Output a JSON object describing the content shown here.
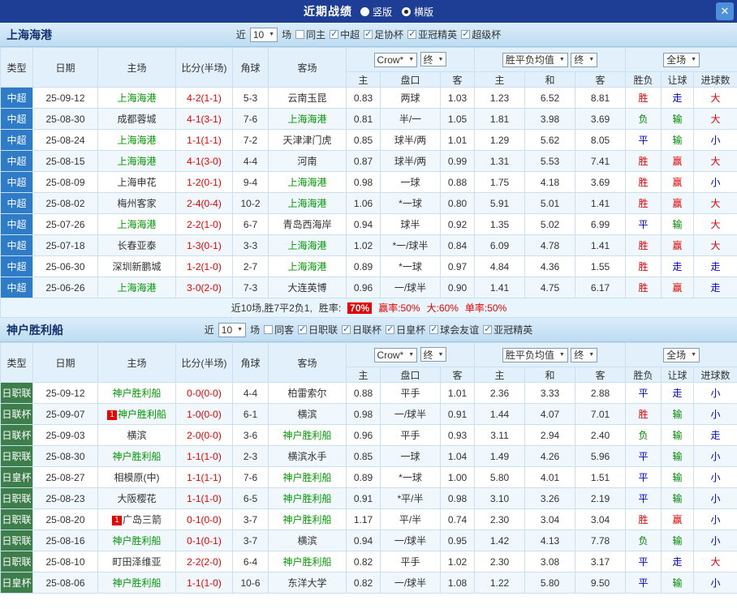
{
  "topbar": {
    "title": "近期战绩",
    "options": [
      {
        "label": "竖版",
        "selected": false
      },
      {
        "label": "横版",
        "selected": true
      }
    ],
    "close_icon": "✕"
  },
  "colors": {
    "topbar_bg": "#1d3e94",
    "close_bg": "#4d8fdb",
    "band_bg": "#cde5f6",
    "header_bg": "#e1f0fb",
    "csl_badge": "#2e7bc8",
    "jp_badge": "#3e7e4b",
    "team_selected": "#009900",
    "score": "#e60000",
    "result_red": "#e60000",
    "result_blue": "#0000dd",
    "result_green": "#008800",
    "rate_badge_bg": "#e60000"
  },
  "sections": [
    {
      "team": "上海海港",
      "recent_prefix": "近",
      "recent_count": "10",
      "recent_suffix": "场",
      "filters": [
        {
          "label": "同主",
          "checked": false
        },
        {
          "label": "中超",
          "checked": true
        },
        {
          "label": "足协杯",
          "checked": true
        },
        {
          "label": "亚冠精英",
          "checked": true
        },
        {
          "label": "超级杯",
          "checked": true
        }
      ],
      "dropdowns": [
        {
          "name": "bookmaker-select",
          "label": "Crow*"
        },
        {
          "name": "asia-stage-select",
          "label": "终"
        },
        {
          "name": "europe-odds-select",
          "label": "胜平负均值"
        },
        {
          "name": "europe-stage-select",
          "label": "终"
        },
        {
          "name": "scope-select",
          "label": "全场"
        }
      ],
      "main_headers": [
        "类型",
        "日期",
        "主场",
        "比分(半场)",
        "角球",
        "客场"
      ],
      "sub_headers": [
        "主",
        "盘口",
        "客",
        "主",
        "和",
        "客",
        "胜负",
        "让球",
        "进球数"
      ],
      "rows": [
        {
          "league": "中超",
          "date": "25-09-12",
          "home_badge": "",
          "home": "上海海港",
          "home_selected": true,
          "score": "4-2(1-1)",
          "corners": "5-3",
          "away_badge": "",
          "away": "云南玉昆",
          "away_selected": false,
          "asia_home": "0.83",
          "handicap": "两球",
          "asia_away": "1.03",
          "euro_home": "1.23",
          "euro_draw": "6.52",
          "euro_away": "8.81",
          "result": "胜",
          "handicap_result": "走",
          "goals_result": "大"
        },
        {
          "league": "中超",
          "date": "25-08-30",
          "home_badge": "",
          "home": "成都蓉城",
          "home_selected": false,
          "score": "4-1(3-1)",
          "corners": "7-6",
          "away_badge": "",
          "away": "上海海港",
          "away_selected": true,
          "asia_home": "0.81",
          "handicap": "半/一",
          "asia_away": "1.05",
          "euro_home": "1.81",
          "euro_draw": "3.98",
          "euro_away": "3.69",
          "result": "负",
          "handicap_result": "输",
          "goals_result": "大"
        },
        {
          "league": "中超",
          "date": "25-08-24",
          "home_badge": "",
          "home": "上海海港",
          "home_selected": true,
          "score": "1-1(1-1)",
          "corners": "7-2",
          "away_badge": "",
          "away": "天津津门虎",
          "away_selected": false,
          "asia_home": "0.85",
          "handicap": "球半/两",
          "asia_away": "1.01",
          "euro_home": "1.29",
          "euro_draw": "5.62",
          "euro_away": "8.05",
          "result": "平",
          "handicap_result": "输",
          "goals_result": "小"
        },
        {
          "league": "中超",
          "date": "25-08-15",
          "home_badge": "",
          "home": "上海海港",
          "home_selected": true,
          "score": "4-1(3-0)",
          "corners": "4-4",
          "away_badge": "",
          "away": "河南",
          "away_selected": false,
          "asia_home": "0.87",
          "handicap": "球半/两",
          "asia_away": "0.99",
          "euro_home": "1.31",
          "euro_draw": "5.53",
          "euro_away": "7.41",
          "result": "胜",
          "handicap_result": "赢",
          "goals_result": "大"
        },
        {
          "league": "中超",
          "date": "25-08-09",
          "home_badge": "",
          "home": "上海申花",
          "home_selected": false,
          "score": "1-2(0-1)",
          "corners": "9-4",
          "away_badge": "",
          "away": "上海海港",
          "away_selected": true,
          "asia_home": "0.98",
          "handicap": "一球",
          "asia_away": "0.88",
          "euro_home": "1.75",
          "euro_draw": "4.18",
          "euro_away": "3.69",
          "result": "胜",
          "handicap_result": "赢",
          "goals_result": "小"
        },
        {
          "league": "中超",
          "date": "25-08-02",
          "home_badge": "",
          "home": "梅州客家",
          "home_selected": false,
          "score": "2-4(0-4)",
          "corners": "10-2",
          "away_badge": "",
          "away": "上海海港",
          "away_selected": true,
          "asia_home": "1.06",
          "handicap": "*一球",
          "asia_away": "0.80",
          "euro_home": "5.91",
          "euro_draw": "5.01",
          "euro_away": "1.41",
          "result": "胜",
          "handicap_result": "赢",
          "goals_result": "大"
        },
        {
          "league": "中超",
          "date": "25-07-26",
          "home_badge": "",
          "home": "上海海港",
          "home_selected": true,
          "score": "2-2(1-0)",
          "corners": "6-7",
          "away_badge": "",
          "away": "青岛西海岸",
          "away_selected": false,
          "asia_home": "0.94",
          "handicap": "球半",
          "asia_away": "0.92",
          "euro_home": "1.35",
          "euro_draw": "5.02",
          "euro_away": "6.99",
          "result": "平",
          "handicap_result": "输",
          "goals_result": "大"
        },
        {
          "league": "中超",
          "date": "25-07-18",
          "home_badge": "",
          "home": "长春亚泰",
          "home_selected": false,
          "score": "1-3(0-1)",
          "corners": "3-3",
          "away_badge": "",
          "away": "上海海港",
          "away_selected": true,
          "asia_home": "1.02",
          "handicap": "*一/球半",
          "asia_away": "0.84",
          "euro_home": "6.09",
          "euro_draw": "4.78",
          "euro_away": "1.41",
          "result": "胜",
          "handicap_result": "赢",
          "goals_result": "大"
        },
        {
          "league": "中超",
          "date": "25-06-30",
          "home_badge": "",
          "home": "深圳新鹏城",
          "home_selected": false,
          "score": "1-2(1-0)",
          "corners": "2-7",
          "away_badge": "",
          "away": "上海海港",
          "away_selected": true,
          "asia_home": "0.89",
          "handicap": "*一球",
          "asia_away": "0.97",
          "euro_home": "4.84",
          "euro_draw": "4.36",
          "euro_away": "1.55",
          "result": "胜",
          "handicap_result": "走",
          "goals_result": "走"
        },
        {
          "league": "中超",
          "date": "25-06-26",
          "home_badge": "",
          "home": "上海海港",
          "home_selected": true,
          "score": "3-0(2-0)",
          "corners": "7-3",
          "away_badge": "",
          "away": "大连英博",
          "away_selected": false,
          "asia_home": "0.96",
          "handicap": "一/球半",
          "asia_away": "0.90",
          "euro_home": "1.41",
          "euro_draw": "4.75",
          "euro_away": "6.17",
          "result": "胜",
          "handicap_result": "赢",
          "goals_result": "走"
        }
      ],
      "summary": {
        "record": "近10场,胜7平2负1,",
        "win_rate_label": "胜率:",
        "win_rate": "70%",
        "stats": [
          "赢率:50%",
          "大:60%",
          "单率:50%"
        ]
      }
    },
    {
      "team": "神户胜利船",
      "recent_prefix": "近",
      "recent_count": "10",
      "recent_suffix": "场",
      "filters": [
        {
          "label": "同客",
          "checked": false
        },
        {
          "label": "日职联",
          "checked": true
        },
        {
          "label": "日联杯",
          "checked": true
        },
        {
          "label": "日皇杯",
          "checked": true
        },
        {
          "label": "球会友谊",
          "checked": true
        },
        {
          "label": "亚冠精英",
          "checked": true
        }
      ],
      "dropdowns": [
        {
          "name": "bookmaker-select",
          "label": "Crow*"
        },
        {
          "name": "asia-stage-select",
          "label": "终"
        },
        {
          "name": "europe-odds-select",
          "label": "胜平负均值"
        },
        {
          "name": "europe-stage-select",
          "label": "终"
        },
        {
          "name": "scope-select",
          "label": "全场"
        }
      ],
      "main_headers": [
        "类型",
        "日期",
        "主场",
        "比分(半场)",
        "角球",
        "客场"
      ],
      "sub_headers": [
        "主",
        "盘口",
        "客",
        "主",
        "和",
        "客",
        "胜负",
        "让球",
        "进球数"
      ],
      "rows": [
        {
          "league": "日职联",
          "date": "25-09-12",
          "home_badge": "",
          "home": "神户胜利船",
          "home_selected": true,
          "score": "0-0(0-0)",
          "corners": "4-4",
          "away_badge": "",
          "away": "柏雷索尔",
          "away_selected": false,
          "asia_home": "0.88",
          "handicap": "平手",
          "asia_away": "1.01",
          "euro_home": "2.36",
          "euro_draw": "3.33",
          "euro_away": "2.88",
          "result": "平",
          "handicap_result": "走",
          "goals_result": "小"
        },
        {
          "league": "日联杯",
          "date": "25-09-07",
          "home_badge": "1",
          "home": "神户胜利船",
          "home_selected": true,
          "score": "1-0(0-0)",
          "corners": "6-1",
          "away_badge": "",
          "away": "横滨",
          "away_selected": false,
          "asia_home": "0.98",
          "handicap": "一/球半",
          "asia_away": "0.91",
          "euro_home": "1.44",
          "euro_draw": "4.07",
          "euro_away": "7.01",
          "result": "胜",
          "handicap_result": "输",
          "goals_result": "小"
        },
        {
          "league": "日联杯",
          "date": "25-09-03",
          "home_badge": "",
          "home": "横滨",
          "home_selected": false,
          "score": "2-0(0-0)",
          "corners": "3-6",
          "away_badge": "",
          "away": "神户胜利船",
          "away_selected": true,
          "asia_home": "0.96",
          "handicap": "平手",
          "asia_away": "0.93",
          "euro_home": "3.11",
          "euro_draw": "2.94",
          "euro_away": "2.40",
          "result": "负",
          "handicap_result": "输",
          "goals_result": "走"
        },
        {
          "league": "日职联",
          "date": "25-08-30",
          "home_badge": "",
          "home": "神户胜利船",
          "home_selected": true,
          "score": "1-1(1-0)",
          "corners": "2-3",
          "away_badge": "",
          "away": "横滨水手",
          "away_selected": false,
          "asia_home": "0.85",
          "handicap": "一球",
          "asia_away": "1.04",
          "euro_home": "1.49",
          "euro_draw": "4.26",
          "euro_away": "5.96",
          "result": "平",
          "handicap_result": "输",
          "goals_result": "小"
        },
        {
          "league": "日皇杯",
          "date": "25-08-27",
          "home_badge": "",
          "home": "相模原(中)",
          "home_selected": false,
          "score": "1-1(1-1)",
          "corners": "7-6",
          "away_badge": "",
          "away": "神户胜利船",
          "away_selected": true,
          "asia_home": "0.89",
          "handicap": "*一球",
          "asia_away": "1.00",
          "euro_home": "5.80",
          "euro_draw": "4.01",
          "euro_away": "1.51",
          "result": "平",
          "handicap_result": "输",
          "goals_result": "小"
        },
        {
          "league": "日职联",
          "date": "25-08-23",
          "home_badge": "",
          "home": "大阪樱花",
          "home_selected": false,
          "score": "1-1(1-0)",
          "corners": "6-5",
          "away_badge": "",
          "away": "神户胜利船",
          "away_selected": true,
          "asia_home": "0.91",
          "handicap": "*平/半",
          "asia_away": "0.98",
          "euro_home": "3.10",
          "euro_draw": "3.26",
          "euro_away": "2.19",
          "result": "平",
          "handicap_result": "输",
          "goals_result": "小"
        },
        {
          "league": "日职联",
          "date": "25-08-20",
          "home_badge": "1",
          "home": "广岛三箭",
          "home_selected": false,
          "score": "0-1(0-0)",
          "corners": "3-7",
          "away_badge": "",
          "away": "神户胜利船",
          "away_selected": true,
          "asia_home": "1.17",
          "handicap": "平/半",
          "asia_away": "0.74",
          "euro_home": "2.30",
          "euro_draw": "3.04",
          "euro_away": "3.04",
          "result": "胜",
          "handicap_result": "赢",
          "goals_result": "小"
        },
        {
          "league": "日职联",
          "date": "25-08-16",
          "home_badge": "",
          "home": "神户胜利船",
          "home_selected": true,
          "score": "0-1(0-1)",
          "corners": "3-7",
          "away_badge": "",
          "away": "横滨",
          "away_selected": false,
          "asia_home": "0.94",
          "handicap": "一/球半",
          "asia_away": "0.95",
          "euro_home": "1.42",
          "euro_draw": "4.13",
          "euro_away": "7.78",
          "result": "负",
          "handicap_result": "输",
          "goals_result": "小"
        },
        {
          "league": "日职联",
          "date": "25-08-10",
          "home_badge": "",
          "home": "町田泽维亚",
          "home_selected": false,
          "score": "2-2(2-0)",
          "corners": "6-4",
          "away_badge": "",
          "away": "神户胜利船",
          "away_selected": true,
          "asia_home": "0.82",
          "handicap": "平手",
          "asia_away": "1.02",
          "euro_home": "2.30",
          "euro_draw": "3.08",
          "euro_away": "3.17",
          "result": "平",
          "handicap_result": "走",
          "goals_result": "大"
        },
        {
          "league": "日皇杯",
          "date": "25-08-06",
          "home_badge": "",
          "home": "神户胜利船",
          "home_selected": true,
          "score": "1-1(1-0)",
          "corners": "10-6",
          "away_badge": "",
          "away": "东洋大学",
          "away_selected": false,
          "asia_home": "0.82",
          "handicap": "一/球半",
          "asia_away": "1.08",
          "euro_home": "1.22",
          "euro_draw": "5.80",
          "euro_away": "9.50",
          "result": "平",
          "handicap_result": "输",
          "goals_result": "小"
        }
      ],
      "summary": null
    }
  ]
}
